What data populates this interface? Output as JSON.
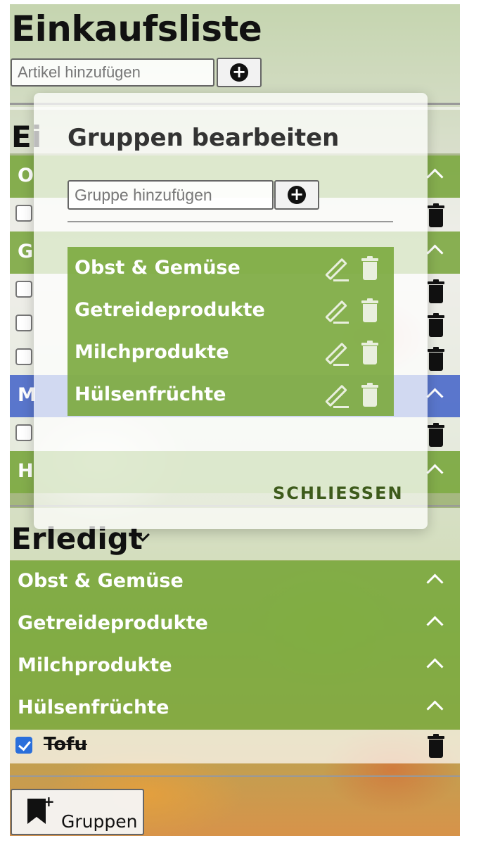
{
  "header": {
    "title": "Einkaufsliste",
    "add_placeholder": "Artikel hinzufügen",
    "add_button_icon": "plus-circle-icon"
  },
  "open_section": {
    "title": "Ei",
    "groups": [
      {
        "label": "O",
        "color": "#7daa41",
        "items": 1
      },
      {
        "label": "G",
        "color": "#7daa41",
        "items": 3
      },
      {
        "label": "M",
        "color": "#506ed2",
        "items": 1
      },
      {
        "label": "H",
        "color": "#7daa41",
        "items": 0
      }
    ]
  },
  "done_section": {
    "title": "Erledigt",
    "groups": [
      {
        "label": "Obst & Gemüse"
      },
      {
        "label": "Getreideprodukte"
      },
      {
        "label": "Milchprodukte"
      },
      {
        "label": "Hülsenfrüchte"
      }
    ],
    "items": [
      {
        "label": "Tofu",
        "checked": true
      }
    ]
  },
  "footer": {
    "groups_button_label": "Gruppen",
    "groups_button_icon": "bookmark-add-icon"
  },
  "modal": {
    "title": "Gruppen bearbeiten",
    "add_placeholder": "Gruppe hinzufügen",
    "groups": [
      {
        "label": "Obst & Gemüse"
      },
      {
        "label": "Getreideprodukte"
      },
      {
        "label": "Milchprodukte"
      },
      {
        "label": "Hülsenfrüchte"
      }
    ],
    "close_label": "SCHLIESSEN"
  },
  "colors": {
    "group_green": "#7daa41",
    "group_blue": "#506ed2",
    "checkbox_blue": "#2a6fdb"
  }
}
